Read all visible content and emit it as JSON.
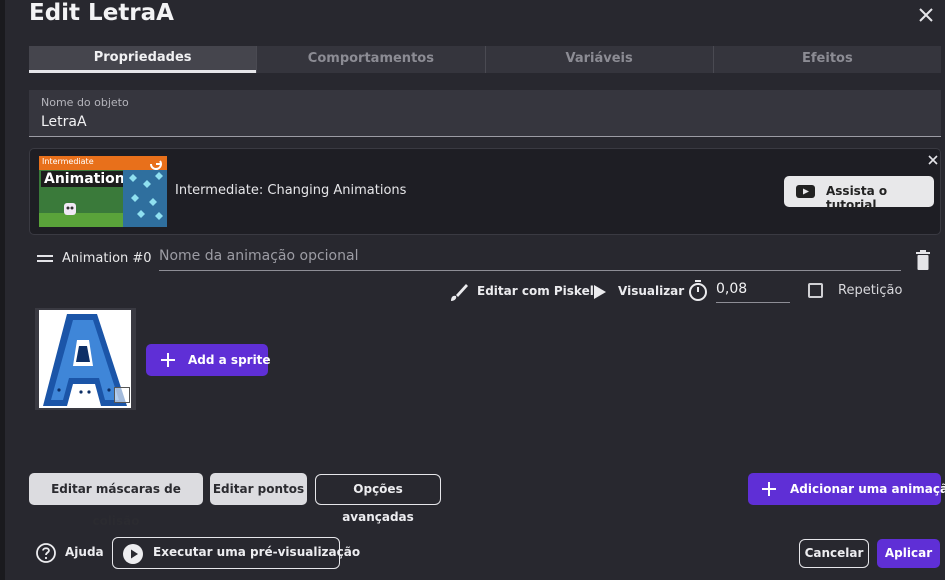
{
  "dialog": {
    "title": "Edit LetraA"
  },
  "tabs": [
    {
      "label": "Propriedades",
      "active": true
    },
    {
      "label": "Comportamentos",
      "active": false
    },
    {
      "label": "Variáveis",
      "active": false
    },
    {
      "label": "Efeitos",
      "active": false
    }
  ],
  "object_name": {
    "label": "Nome do objeto",
    "value": "LetraA"
  },
  "tutorial": {
    "thumbnail_badge": "Intermediate",
    "thumbnail_title": "Animations",
    "title": "Intermediate: Changing Animations",
    "watch_label": "Assista o tutorial"
  },
  "animation": {
    "label": "Animation #0",
    "name_placeholder": "Nome da animação opcional",
    "edit_piskel_label": "Editar com Piskel",
    "preview_label": "Visualizar",
    "speed_value": "0,08",
    "loop_label": "Repetição",
    "loop_checked": false,
    "add_sprite_label": "Add a sprite"
  },
  "buttons": {
    "collision_masks": "Editar máscaras de colisão",
    "edit_points": "Editar pontos",
    "advanced_options": "Opções avançadas",
    "add_animation": "Adicionar uma animação"
  },
  "footer": {
    "help_label": "Ajuda",
    "preview_label": "Executar uma pré-visualização",
    "cancel_label": "Cancelar",
    "apply_label": "Aplicar"
  },
  "colors": {
    "background": "#28282f",
    "accent_purple": "#5f2fd6",
    "input_bg": "#36363e"
  }
}
